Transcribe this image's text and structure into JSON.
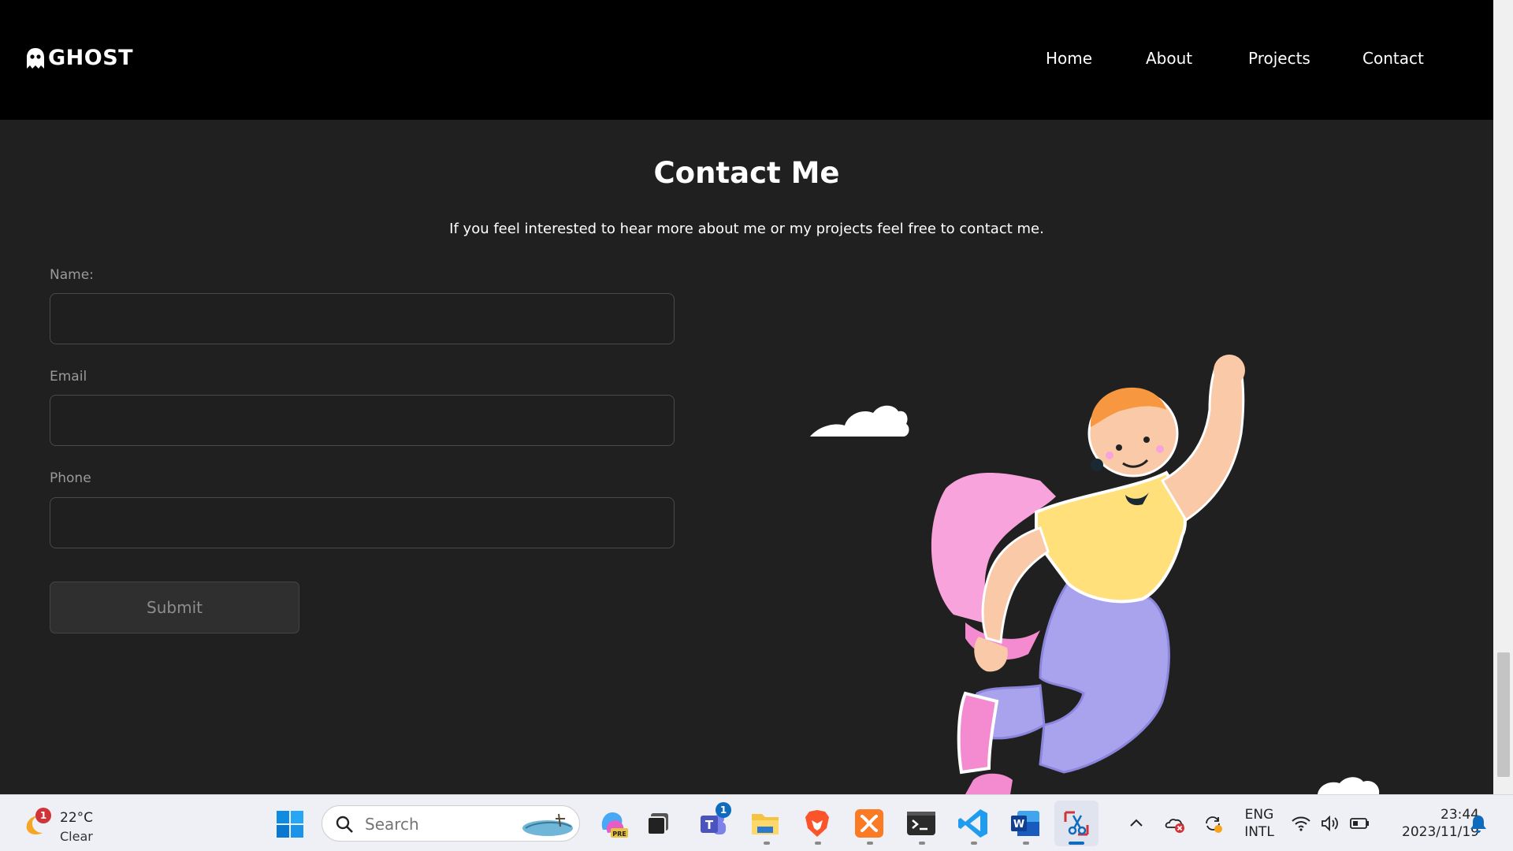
{
  "navbar": {
    "brand": "GHOST",
    "links": [
      "Home",
      "About",
      "Projects",
      "Contact"
    ]
  },
  "contact": {
    "title": "Contact Me",
    "subtitle": "If you feel interested to hear more about me or my projects feel free to contact me.",
    "fields": [
      {
        "label": "Name:",
        "value": ""
      },
      {
        "label": "Email",
        "value": ""
      },
      {
        "label": "Phone",
        "value": ""
      }
    ],
    "submit_label": "Submit"
  },
  "taskbar": {
    "weather": {
      "temp": "22°C",
      "condition": "Clear",
      "badge": "1"
    },
    "search_placeholder": "Search",
    "apps": [
      {
        "icon": "copilot-pre-icon"
      },
      {
        "icon": "task-view-icon"
      },
      {
        "icon": "teams-icon",
        "badge": "1"
      },
      {
        "icon": "file-explorer-icon"
      },
      {
        "icon": "brave-browser-icon"
      },
      {
        "icon": "xampp-icon"
      },
      {
        "icon": "terminal-icon"
      },
      {
        "icon": "vscode-icon"
      },
      {
        "icon": "word-icon"
      },
      {
        "icon": "snipping-tool-icon"
      }
    ],
    "tray": {
      "lang_line1": "ENG",
      "lang_line2": "INTL",
      "time": "23:44",
      "date": "2023/11/19"
    }
  },
  "colors": {
    "page_bg": "#202020",
    "navbar_bg": "#000000",
    "taskbar_bg": "#eef0f5",
    "accent_blue": "#0f6cbd"
  }
}
